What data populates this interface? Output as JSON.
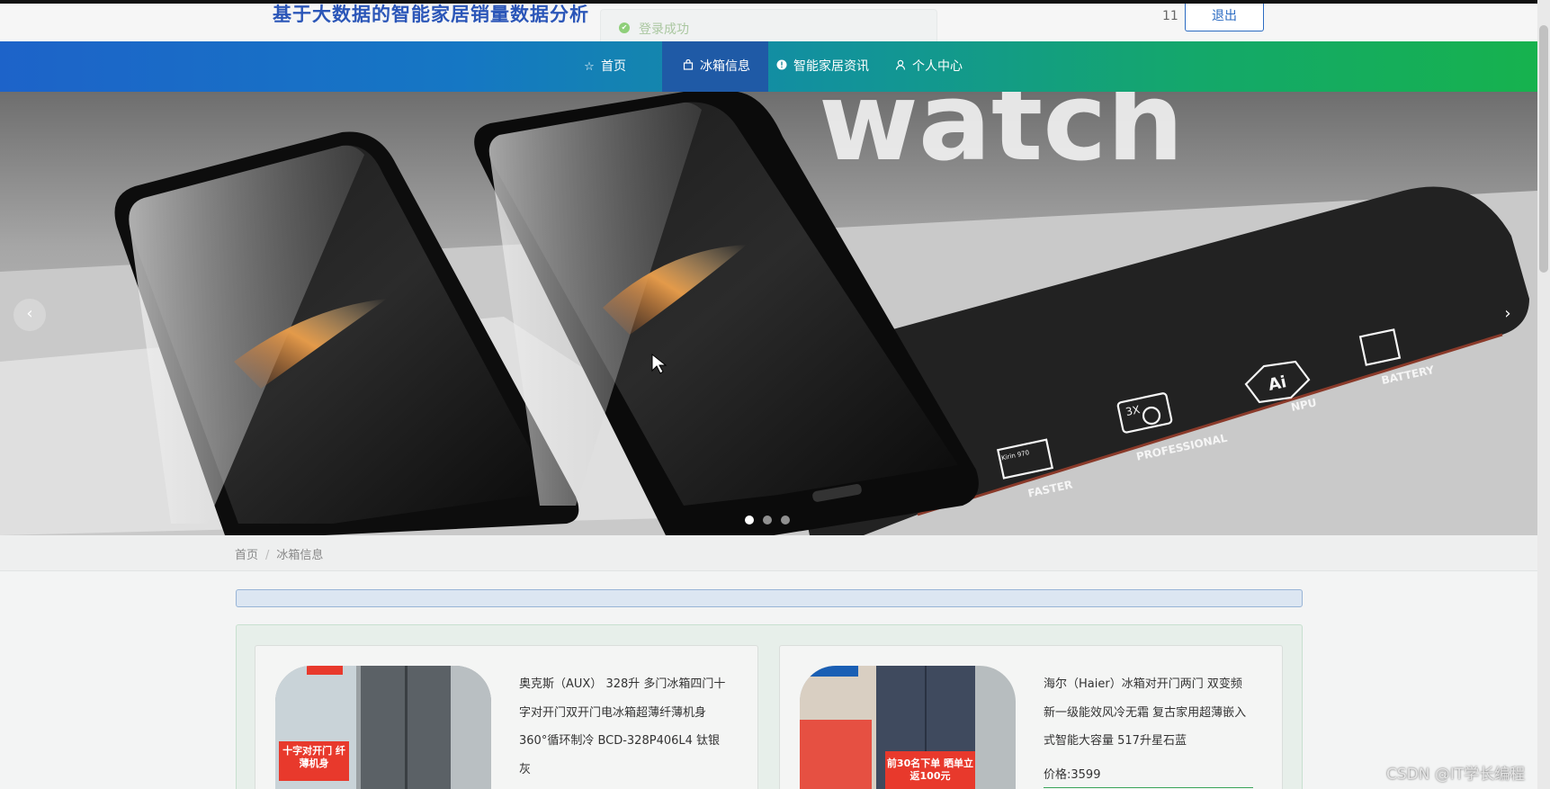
{
  "header": {
    "site_title": "基于大数据的智能家居销量数据分析",
    "toast": "登录成功",
    "username": "11",
    "logout_label": "退出"
  },
  "nav": {
    "items": [
      {
        "label": "首页",
        "icon": "star-icon"
      },
      {
        "label": "冰箱信息",
        "icon": "bag-icon"
      },
      {
        "label": "智能家居资讯",
        "icon": "info-icon"
      },
      {
        "label": "个人中心",
        "icon": "user-icon"
      }
    ],
    "active_index": 1
  },
  "banner": {
    "labels": [
      "FASTER",
      "PROFESSIONAL",
      "NPU",
      "BATTERY"
    ],
    "chip_text": "Kirin 970",
    "camera_text": "3X",
    "ai_text": "Ai",
    "slide_count": 3,
    "active_slide": 0
  },
  "breadcrumb": {
    "home": "首页",
    "separator": "/",
    "current": "冰箱信息"
  },
  "products": [
    {
      "name": "奥克斯（AUX） 328升 多门冰箱四门十字对开门双开门电冰箱超薄纤薄机身 360°循环制冷 BCD-328P406L4 钛银灰",
      "price": "",
      "badge": "十字对开门 纤薄机身"
    },
    {
      "name": "海尔（Haier）冰箱对开门两门 双变频 新一级能效风冷无霜 复古家用超薄嵌入式智能大容量 517升星石蓝",
      "price": "价格:3599",
      "badge": "前30名下单 晒单立返100元"
    }
  ],
  "watermark": "CSDN @IT学长编程",
  "colors": {
    "brand_blue": "#2b56b8",
    "nav_start": "#1d63c9",
    "nav_end": "#16b24e",
    "active_nav": "#1f5aa6",
    "accent_green": "#3aa55a"
  }
}
